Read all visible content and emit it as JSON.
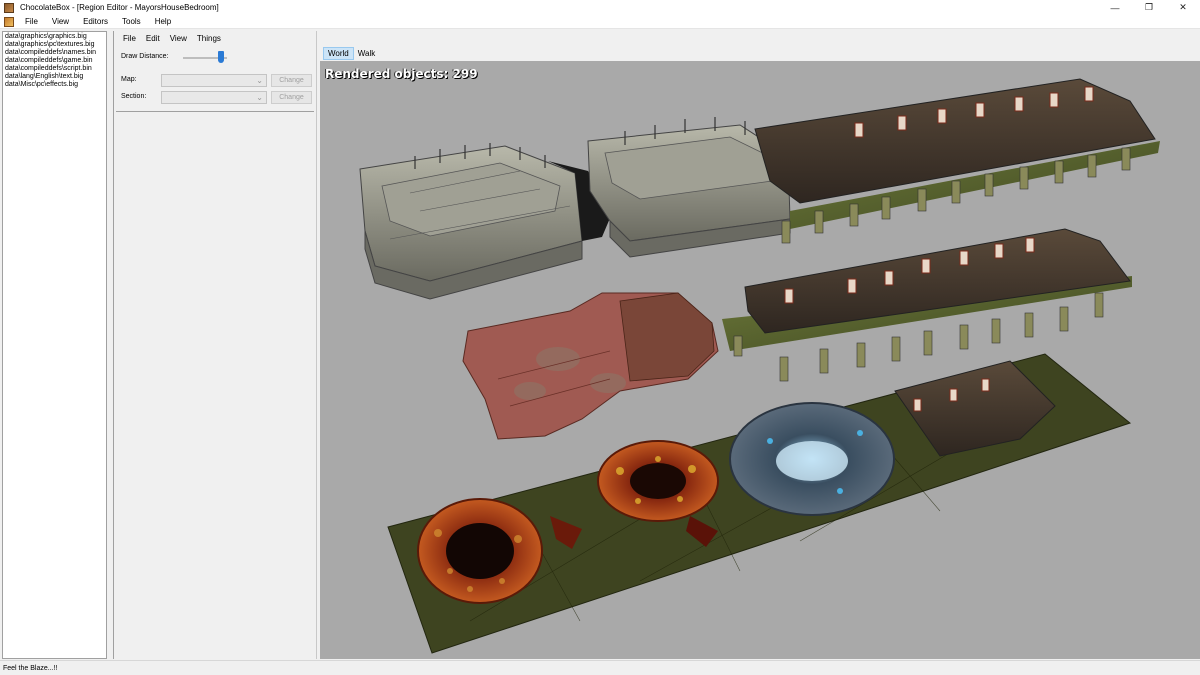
{
  "window": {
    "title": "ChocolateBox - [Region Editor - MayorsHouseBedroom]",
    "minimize_glyph": "—",
    "maximize_glyph": "❐",
    "close_glyph": "✕"
  },
  "menu": [
    "File",
    "View",
    "Editors",
    "Tools",
    "Help"
  ],
  "files": [
    "data\\graphics\\graphics.big",
    "data\\graphics\\pc\\textures.big",
    "data\\compileddefs\\names.bin",
    "data\\compileddefs\\game.bin",
    "data\\compileddefs\\script.bin",
    "data\\lang\\English\\text.big",
    "data\\Misc\\pc\\effects.big"
  ],
  "region_editor": {
    "menu": [
      "File",
      "Edit",
      "View",
      "Things"
    ],
    "draw_distance_label": "Draw Distance:",
    "draw_distance_level": 0.85,
    "map_label": "Map:",
    "section_label": "Section:",
    "change_label": "Change"
  },
  "viewport": {
    "tabs": [
      "World",
      "Walk"
    ],
    "active_tab": "World",
    "rendered_objects": "Rendered objects: 299"
  },
  "status": "Feel the Blaze...!!"
}
